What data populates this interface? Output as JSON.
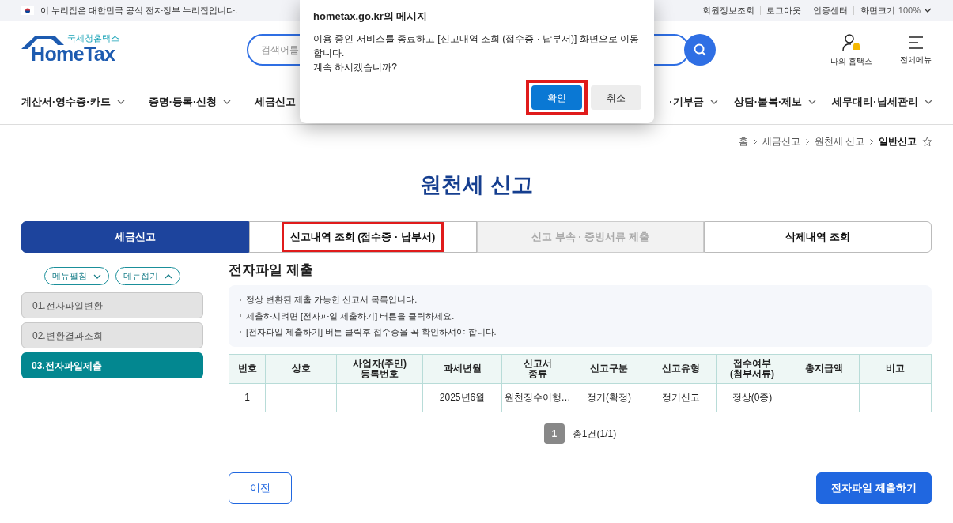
{
  "gov_banner": {
    "text": "이 누리집은 대한민국 공식 전자정부 누리집입니다."
  },
  "top_links": [
    "회원정보조회",
    "로그아웃",
    "인증센터"
  ],
  "zoom_control": {
    "label": "화면크기",
    "value": "100%"
  },
  "logo": {
    "tagline": "국세청홈택스",
    "name": "HomeTax"
  },
  "search": {
    "placeholder": "검색어를"
  },
  "header_icons": [
    {
      "kind": "user",
      "label": "나의 홈택스"
    },
    {
      "kind": "menu",
      "label": "전체메뉴"
    }
  ],
  "nav": [
    {
      "label": "계산서·영수증·카드",
      "caret": true
    },
    {
      "label": "증명·등록·신청",
      "caret": true
    },
    {
      "label": "세금신고",
      "caret": false
    },
    {
      "label": "·기부금",
      "caret": true
    },
    {
      "label": "상담·불복·제보",
      "caret": true
    },
    {
      "label": "세무대리·납세관리",
      "caret": true
    }
  ],
  "dialog": {
    "title": "hometax.go.kr의 메시지",
    "message": "이용 중인 서비스를 종료하고 [신고내역 조회 (접수증 · 납부서)] 화면으로 이동합니다.\n계속 하시겠습니까?",
    "buttons": [
      {
        "label": "확인",
        "kind": "primary",
        "highlighted": true
      },
      {
        "label": "취소",
        "kind": "secondary",
        "highlighted": false
      }
    ]
  },
  "breadcrumb": [
    {
      "label": "홈",
      "current": false
    },
    {
      "label": "세금신고",
      "current": false
    },
    {
      "label": "원천세 신고",
      "current": false
    },
    {
      "label": "일반신고",
      "current": true
    }
  ],
  "page_title": "원천세 신고",
  "tabs": [
    {
      "label": "세금신고",
      "selected": true,
      "disabled": false,
      "highlighted": false
    },
    {
      "label": "신고내역 조회 (접수증 · 납부서)",
      "selected": false,
      "disabled": false,
      "highlighted": true
    },
    {
      "label": "신고 부속 · 증빙서류 제출",
      "selected": false,
      "disabled": true,
      "highlighted": false
    },
    {
      "label": "삭제내역 조회",
      "selected": false,
      "disabled": false,
      "highlighted": false
    }
  ],
  "menu_toggles": [
    {
      "label": "메뉴펼침",
      "kind": "expand"
    },
    {
      "label": "메뉴접기",
      "kind": "collapse"
    }
  ],
  "steps": [
    {
      "label": "01.전자파일변환",
      "selected": false
    },
    {
      "label": "02.변환결과조회",
      "selected": false
    },
    {
      "label": "03.전자파일제출",
      "selected": true
    }
  ],
  "section_title": "전자파일 제출",
  "notes": [
    "정상 변환된 제출 가능한 신고서 목록입니다.",
    "제출하시려면 [전자파일 제출하기] 버튼을 클릭하세요.",
    "[전자파일 제출하기] 버튼 클릭후 접수증을 꼭 확인하셔야 합니다."
  ],
  "table": {
    "columns": [
      "번호",
      "상호",
      "사업자(주민)\n등록번호",
      "과세년월",
      "신고서\n종류",
      "신고구분",
      "신고유형",
      "접수여부\n(첨부서류)",
      "총지급액",
      "비고"
    ],
    "rows": [
      [
        "1",
        null,
        null,
        "2025년6월",
        "원천징수이행…",
        "정기(확정)",
        "정기신고",
        "정상(0종)",
        null,
        null
      ]
    ]
  },
  "pagination": {
    "pages": [
      {
        "label": "1",
        "selected": true
      }
    ],
    "summary": "총1건(1/1)"
  },
  "buttons": [
    {
      "label": "이전",
      "kind": "outline"
    },
    {
      "label": "전자파일 제출하기",
      "kind": "primary"
    }
  ]
}
